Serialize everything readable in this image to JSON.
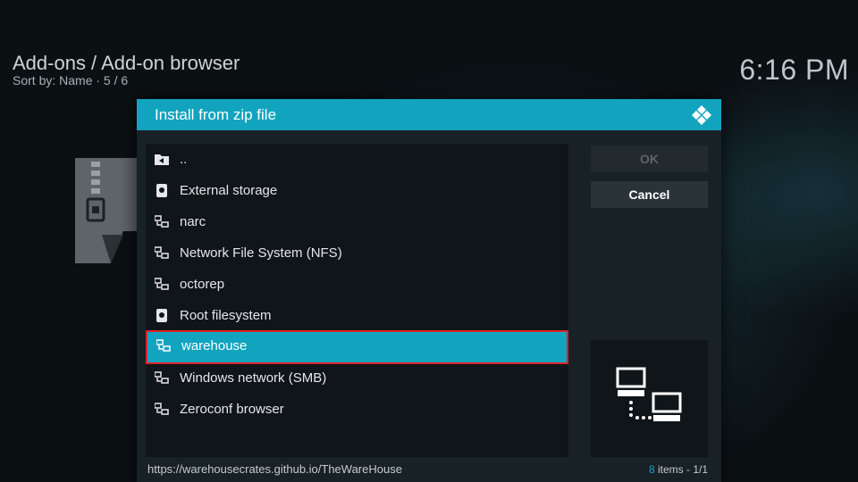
{
  "header": {
    "breadcrumb": "Add-ons / Add-on browser",
    "sort_info": "Sort by: Name  · 5 / 6"
  },
  "clock": "6:16 PM",
  "dialog": {
    "title": "Install from zip file",
    "items": [
      {
        "label": "..",
        "icon": "folder-back-icon",
        "selected": false
      },
      {
        "label": "External storage",
        "icon": "drive-icon",
        "selected": false
      },
      {
        "label": "narc",
        "icon": "network-icon",
        "selected": false
      },
      {
        "label": "Network File System (NFS)",
        "icon": "network-icon",
        "selected": false
      },
      {
        "label": "octorep",
        "icon": "network-icon",
        "selected": false
      },
      {
        "label": "Root filesystem",
        "icon": "drive-icon",
        "selected": false
      },
      {
        "label": "warehouse",
        "icon": "network-icon",
        "selected": true
      },
      {
        "label": "Windows network (SMB)",
        "icon": "network-icon",
        "selected": false
      },
      {
        "label": "Zeroconf browser",
        "icon": "network-icon",
        "selected": false
      }
    ],
    "ok_label": "OK",
    "cancel_label": "Cancel",
    "preview_icon": "network-computers-icon",
    "footer_path": "https://warehousecrates.github.io/TheWareHouse",
    "footer_count_num": "8",
    "footer_count_text": "items - 1/1"
  },
  "colors": {
    "accent": "#12a4bf",
    "selection_border": "#e0222a"
  }
}
